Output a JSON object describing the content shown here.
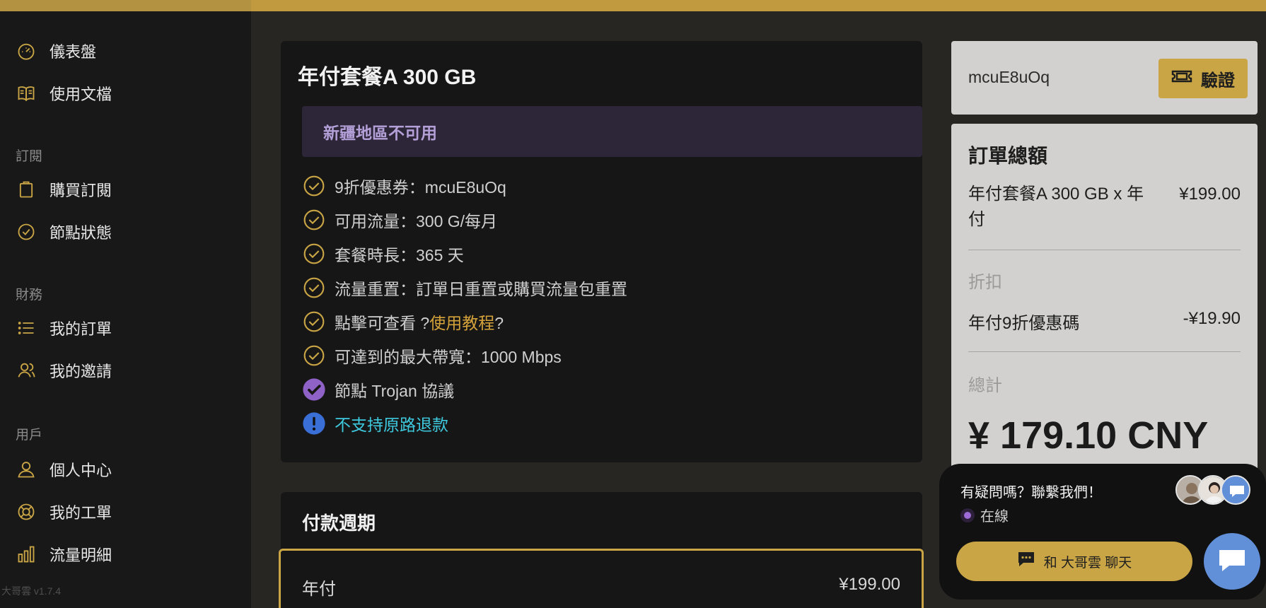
{
  "app": {
    "version": "大哥雲 v1.7.4"
  },
  "sidebar": {
    "items_top": [
      {
        "label": "儀表盤",
        "icon": "speedometer-icon"
      },
      {
        "label": "使用文檔",
        "icon": "book-icon"
      }
    ],
    "sections": [
      {
        "title": "訂閱",
        "items": [
          {
            "label": "購買訂閱",
            "icon": "clipboard-icon"
          },
          {
            "label": "節點狀態",
            "icon": "check-circle-icon"
          }
        ]
      },
      {
        "title": "財務",
        "items": [
          {
            "label": "我的訂單",
            "icon": "list-icon"
          },
          {
            "label": "我的邀請",
            "icon": "users-icon"
          }
        ]
      },
      {
        "title": "用戶",
        "items": [
          {
            "label": "個人中心",
            "icon": "user-icon"
          },
          {
            "label": "我的工單",
            "icon": "lifebuoy-icon"
          },
          {
            "label": "流量明細",
            "icon": "bar-chart-icon"
          }
        ]
      }
    ]
  },
  "plan": {
    "title": "年付套餐A 300 GB",
    "alert": "新疆地區不可用",
    "features": [
      {
        "text": "9折優惠券：mcuE8uOq"
      },
      {
        "text": "可用流量：300 G/每月"
      },
      {
        "text": "套餐時長：365 天"
      },
      {
        "text": "流量重置：訂單日重置或購買流量包重置"
      },
      {
        "pre": "點擊可查看 ?",
        "link": "使用教程",
        "post": "?"
      },
      {
        "text": "可達到的最大帶寬：1000 Mbps"
      },
      {
        "text": "節點 Trojan 協議"
      },
      {
        "text": "不支持原路退款"
      }
    ]
  },
  "period": {
    "title": "付款週期",
    "option_name": "年付",
    "option_price": "¥199.00"
  },
  "coupon": {
    "code": "mcuE8uOq",
    "verify_label": "驗證"
  },
  "order": {
    "title": "訂單總額",
    "item": "年付套餐A 300 GB x 年付",
    "item_price": "¥199.00",
    "discount_label": "折扣",
    "discount_name": "年付9折優惠碼",
    "discount_value": "-¥19.90",
    "total_label": "總計",
    "total": "¥ 179.10 CNY"
  },
  "chat": {
    "question": "有疑問嗎？聯繫我們！",
    "status": "在線",
    "button": "和 大哥雲 聊天"
  },
  "colors": {
    "accent": "#c9a545",
    "info": "#3ec9de",
    "alert_text": "#b4a0d8",
    "fab": "#6190d9"
  }
}
